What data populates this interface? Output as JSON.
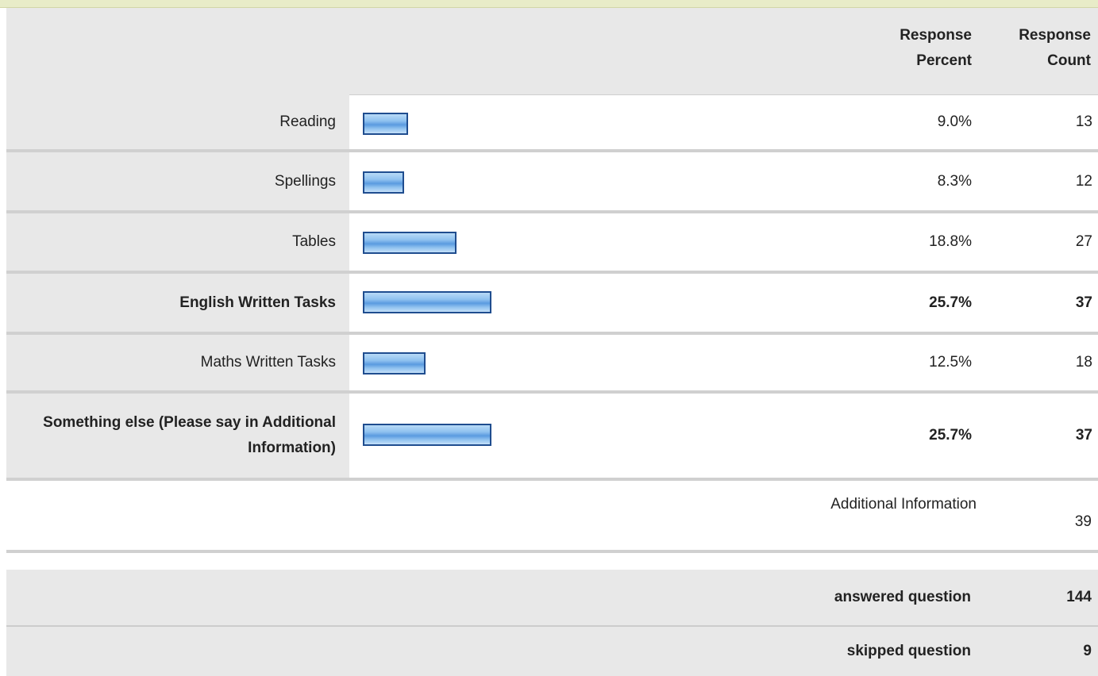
{
  "header": {
    "response_percent": "Response Percent",
    "response_count": "Response Count"
  },
  "rows": [
    {
      "label": "Reading",
      "percent": "9.0%",
      "count": "13",
      "fraction": 0.09,
      "bold": false
    },
    {
      "label": "Spellings",
      "percent": "8.3%",
      "count": "12",
      "fraction": 0.083,
      "bold": false
    },
    {
      "label": "Tables",
      "percent": "18.8%",
      "count": "27",
      "fraction": 0.188,
      "bold": false
    },
    {
      "label": "English Written Tasks",
      "percent": "25.7%",
      "count": "37",
      "fraction": 0.257,
      "bold": true
    },
    {
      "label": "Maths Written Tasks",
      "percent": "12.5%",
      "count": "18",
      "fraction": 0.125,
      "bold": false
    },
    {
      "label": "Something else (Please say in Additional Information)",
      "percent": "25.7%",
      "count": "37",
      "fraction": 0.257,
      "bold": true
    }
  ],
  "additional": {
    "label": "Additional Information",
    "count": "39"
  },
  "summary": {
    "answered_label": "answered question",
    "answered_value": "144",
    "skipped_label": "skipped question",
    "skipped_value": "9"
  },
  "colors": {
    "bar_border": "#1f4d8f",
    "bar_fill": "#8fc1ef",
    "label_bg": "#e8e8e8",
    "top_strip": "#e8ecc8"
  }
}
